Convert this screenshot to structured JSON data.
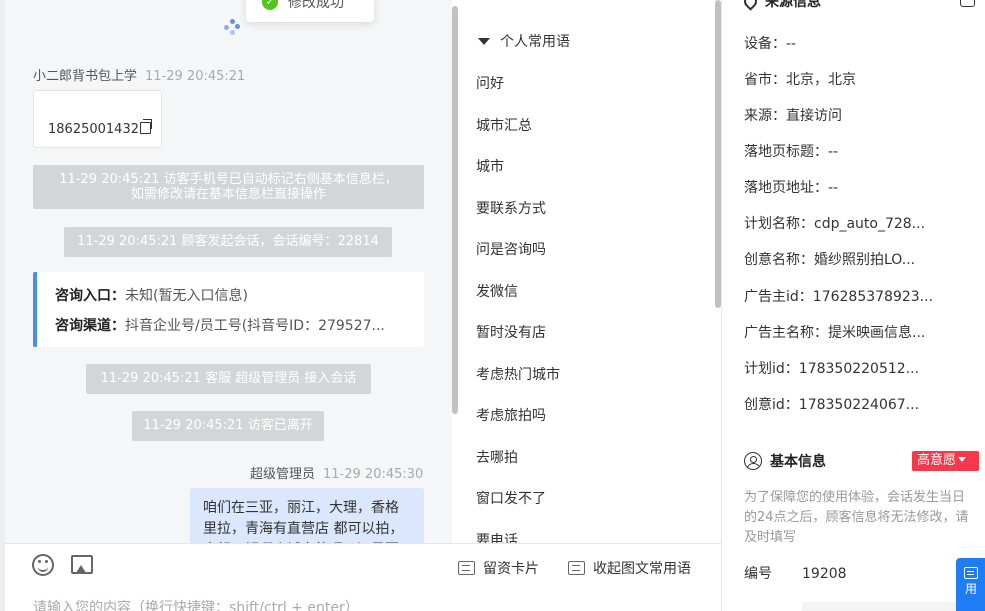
{
  "toast": {
    "text": "修改成功"
  },
  "chat": {
    "visitor_name": "小二郎背书包上学",
    "visitor_time": "11-29 20:45:21",
    "phone": "18625001432",
    "system_messages": [
      "11-29 20:45:21 访客手机号已自动标记右侧基本信息栏，",
      "如需修改请在基本信息栏直接操作",
      "11-29 20:45:21 顾客发起会话，会话编号：22814",
      "11-29 20:45:21 客服 超级管理员 接入会话",
      "11-29 20:45:21 访客已离开"
    ],
    "consult": {
      "entry_label": "咨询入口：",
      "entry_value": "未知(暂无入口信息)",
      "channel_label": "咨询渠道：",
      "channel_value": "抖音企业号/员工号(抖音号ID：279527..."
    },
    "agent_name": "超级管理员",
    "agent_time": "11-29 20:45:30",
    "agent_message": "咱们在三亚，丽江，大理，香格里拉，青海有直营店 都可以拍，方想了解哪个城市的呢？还是否"
  },
  "input": {
    "profile_card_label": "留资卡片",
    "collapse_label": "收起图文常用语",
    "placeholder": "请输入您的内容（换行快捷键：shift/ctrl + enter）"
  },
  "phrases": {
    "group_title": "个人常用语",
    "items": [
      "问好",
      "城市汇总",
      "城市",
      "要联系方式",
      "问是咨询吗",
      "发微信",
      "暂时没有店",
      "考虑热门城市",
      "考虑旅拍吗",
      "去哪拍",
      "窗口发不了",
      "要电话"
    ]
  },
  "source_info": {
    "title": "来源信息",
    "rows": [
      {
        "label": "设备：",
        "value": "--"
      },
      {
        "label": "省市：",
        "value": "北京，北京"
      },
      {
        "label": "来源：",
        "value": "直接访问"
      },
      {
        "label": "落地页标题：",
        "value": "--"
      },
      {
        "label": "落地页地址：",
        "value": "--"
      },
      {
        "label": "计划名称：",
        "value": "cdp_auto_728..."
      },
      {
        "label": "创意名称：",
        "value": "婚纱照别拍LO..."
      },
      {
        "label": "广告主id：",
        "value": "176285378923..."
      },
      {
        "label": "广告主名称：",
        "value": "提米映画信息..."
      },
      {
        "label": "计划id：",
        "value": "178350220512..."
      },
      {
        "label": "创意id：",
        "value": "178350224067..."
      }
    ]
  },
  "basic_info": {
    "title": "基本信息",
    "intent_badge": "高意愿",
    "hint": "为了保障您的使用体验，会话发生当日的24点之后，顾客信息将无法修改，请及时填写",
    "number_label": "编号",
    "number_value": "19208"
  },
  "float_button": {
    "label": "用"
  },
  "colors": {
    "accent": "#1e7cf5",
    "badge": "#f5384a",
    "agent_bubble": "#dbe7fd",
    "system_message": "#d4d5d8"
  }
}
